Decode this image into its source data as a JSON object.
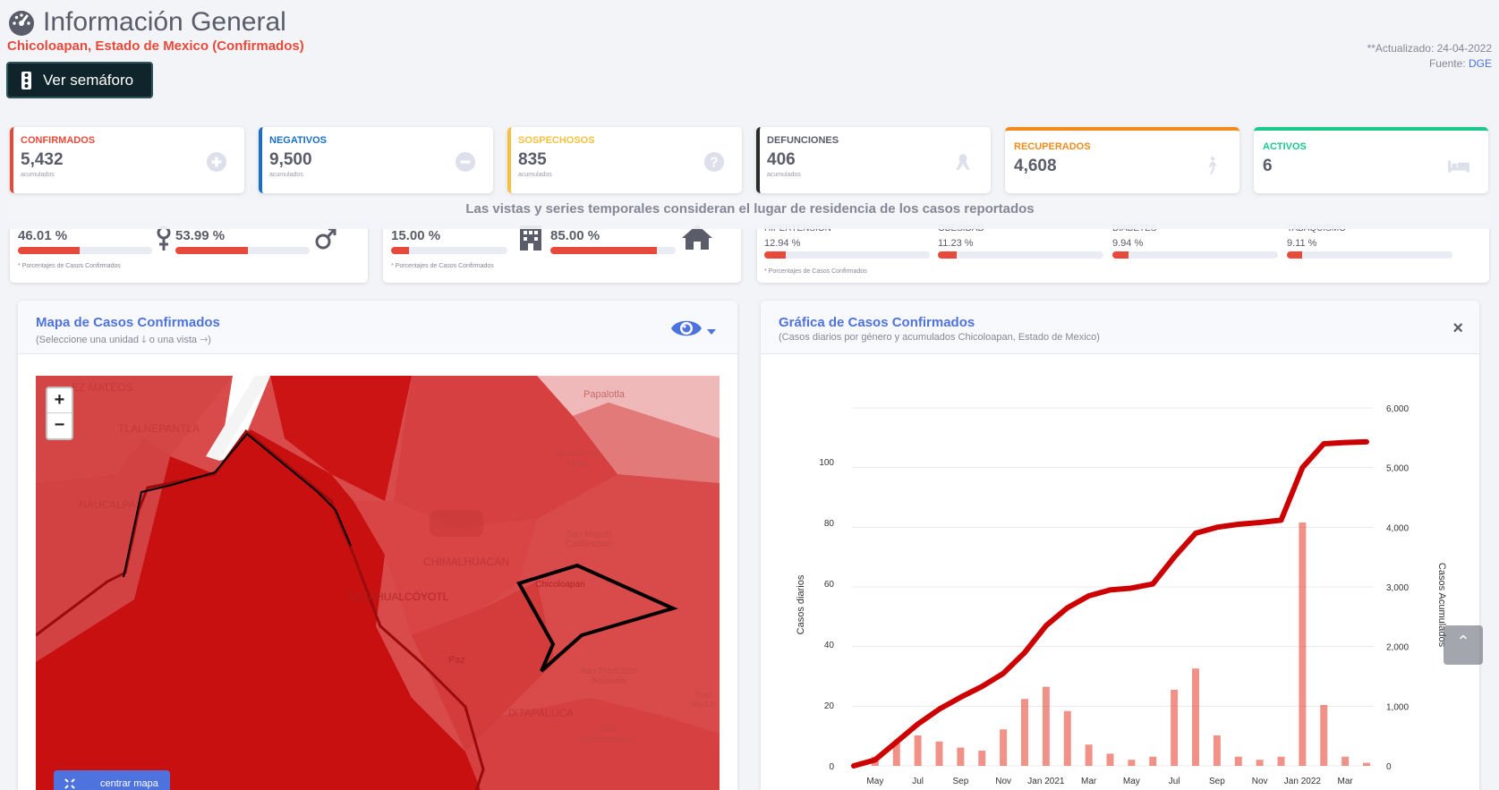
{
  "header": {
    "title": "Información General",
    "subtitle": "Chicoloapan, Estado de Mexico (Confirmados)",
    "semaforo_button": "Ver semáforo",
    "updated": "**Actualizado: 24-04-2022",
    "source_label": "Fuente:",
    "source_link": "DGE"
  },
  "cards": [
    {
      "label": "CONFIRMADOS",
      "value": "5,432",
      "sub": "acumulados",
      "color": "#e74a3b",
      "icon": "plus-circle-icon"
    },
    {
      "label": "NEGATIVOS",
      "value": "9,500",
      "sub": "acumulados",
      "color": "#1a6fc4",
      "icon": "minus-circle-icon"
    },
    {
      "label": "SOSPECHOSOS",
      "value": "835",
      "sub": "acumulados",
      "color": "#f6c23e",
      "icon": "question-circle-icon"
    },
    {
      "label": "DEFUNCIONES",
      "value": "406",
      "sub": "acumulados",
      "color": "#2b2b2b",
      "icon": "ribbon-icon"
    },
    {
      "label": "RECUPERADOS",
      "value": "4,608",
      "sub": "",
      "color": "#f08c1c",
      "icon": "walking-icon"
    },
    {
      "label": "ACTIVOS",
      "value": "6",
      "sub": "",
      "color": "#1cc88a",
      "icon": "bed-icon"
    }
  ],
  "notice": "Las vistas y series temporales consideran el lugar de residencia de los casos reportados",
  "gender": {
    "female": "46.01 %",
    "female_pct": 46.01,
    "male": "53.99 %",
    "male_pct": 53.99,
    "note": "* Porcentajes  de Casos Confirmados"
  },
  "care": {
    "hospital": "15.00 %",
    "hospital_pct": 15.0,
    "home": "85.00 %",
    "home_pct": 85.0,
    "note": "* Porcentajes  de Casos Confirmados"
  },
  "conditions": {
    "items": [
      {
        "label": "HIPERTENSION",
        "value": "12.94 %",
        "pct": 12.94
      },
      {
        "label": "OBESIDAD",
        "value": "11.23 %",
        "pct": 11.23
      },
      {
        "label": "DIABETES",
        "value": "9.94 %",
        "pct": 9.94
      },
      {
        "label": "TABAQUISMO",
        "value": "9.11 %",
        "pct": 9.11
      }
    ],
    "note": "* Porcentajes  de Casos Confirmados"
  },
  "map_panel": {
    "title": "Mapa de Casos Confirmados",
    "subtitle": "(Seleccione una unidad 🡓 o una vista 🡒)",
    "zoom_in": "+",
    "zoom_out": "−",
    "center_button": "centrar mapa",
    "labels": [
      "EZ MATEOS",
      "TLALNEPANTLA",
      "NAUCALPA",
      "Papalotla",
      "Texcoco de Mora",
      "San Miguel Coatlinchán",
      "CHIMALHUACÁN",
      "NEZAHUALCÓYOTL",
      "Chicoloapan",
      "Paz",
      "San Francisco Acuautla",
      "IXTAPALUCA",
      "San Buenaventura",
      "Colo Ma Co"
    ]
  },
  "chart_panel": {
    "title": "Gráfica de Casos Confirmados",
    "subtitle": "(Casos diarios por género y acumulados Chicoloapan, Estado de Mexico)",
    "close": "×"
  },
  "scroll_top": "⌃",
  "chart_data": {
    "type": "line",
    "ylabel": "Casos diarios",
    "y2label": "Casos Acumulados",
    "ylim": [
      0,
      120
    ],
    "y2lim": [
      0,
      6000
    ],
    "yticks": [
      "0",
      "20",
      "40",
      "60",
      "80",
      "100"
    ],
    "y2ticks": [
      "0",
      "1,000",
      "2,000",
      "3,000",
      "4,000",
      "5,000",
      "6,000"
    ],
    "xticks": [
      "May",
      "Jul",
      "Sep",
      "Nov",
      "Jan 2021",
      "Mar",
      "May",
      "Jul",
      "Sep",
      "Nov",
      "Jan 2022",
      "Mar"
    ],
    "series": [
      {
        "name": "Casos Acumulados",
        "color": "#cc0000",
        "x": [
          "Apr 2020",
          "May",
          "Jun",
          "Jul",
          "Aug",
          "Sep",
          "Oct",
          "Nov",
          "Dec",
          "Jan 2021",
          "Feb",
          "Mar",
          "Apr",
          "May",
          "Jun",
          "Jul",
          "Aug",
          "Sep",
          "Oct",
          "Nov",
          "Dec",
          "Jan 2022",
          "Feb",
          "Mar",
          "Apr 2022"
        ],
        "values": [
          0,
          100,
          400,
          700,
          950,
          1150,
          1330,
          1550,
          1900,
          2350,
          2650,
          2850,
          2950,
          2980,
          3050,
          3500,
          3900,
          4000,
          4050,
          4080,
          4120,
          5000,
          5400,
          5420,
          5432
        ]
      },
      {
        "name": "Casos diarios",
        "color": "#e74a3b",
        "x": [
          "Apr 2020",
          "May",
          "Jun",
          "Jul",
          "Aug",
          "Sep",
          "Oct",
          "Nov",
          "Dec",
          "Jan 2021",
          "Feb",
          "Mar",
          "Apr",
          "May",
          "Jun",
          "Jul",
          "Aug",
          "Sep",
          "Oct",
          "Nov",
          "Dec",
          "Jan 2022",
          "Feb",
          "Mar",
          "Apr 2022"
        ],
        "values": [
          0,
          3,
          8,
          10,
          8,
          6,
          5,
          12,
          22,
          26,
          18,
          7,
          4,
          2,
          3,
          25,
          32,
          10,
          3,
          2,
          3,
          80,
          20,
          3,
          1
        ]
      }
    ]
  }
}
